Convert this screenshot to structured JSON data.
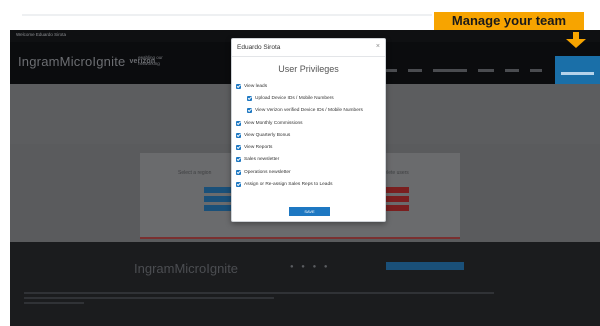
{
  "callout": {
    "text": "Manage your team"
  },
  "site": {
    "welcome_text": "Welcome Eduardo Sirota",
    "logo": "IngramMicroIgnite",
    "logo_partner": "verizon",
    "tagline": "enabling our\nnetworking",
    "panel_text_left": "Select a region",
    "panel_text_right": "to delete users",
    "footer_logo": "IngramMicroIgnite",
    "footer_dots": "● ● ● ●"
  },
  "modal": {
    "user_name": "Eduardo Sirota",
    "close_label": "×",
    "title": "User Privileges",
    "permissions": [
      {
        "label": "View leads",
        "checked": true,
        "indent": false
      },
      {
        "label": "Upload Device IDs / Mobile Numbers",
        "checked": true,
        "indent": true
      },
      {
        "label": "View Verizon verified Device IDs / Mobile Numbers",
        "checked": true,
        "indent": true
      },
      {
        "label": "View Monthly Commissions",
        "checked": true,
        "indent": false
      },
      {
        "label": "View Quarterly Bonus",
        "checked": true,
        "indent": false
      },
      {
        "label": "View Reports",
        "checked": true,
        "indent": false
      },
      {
        "label": "Sales newsletter",
        "checked": true,
        "indent": false
      },
      {
        "label": "Operations newsletter",
        "checked": true,
        "indent": false
      },
      {
        "label": "Assign or Re-assign Sales Reps to Leads",
        "checked": true,
        "indent": false
      }
    ],
    "save_label": "SAVE"
  },
  "colors": {
    "accent_blue": "#1e78c2",
    "callout_orange": "#f7a400"
  }
}
